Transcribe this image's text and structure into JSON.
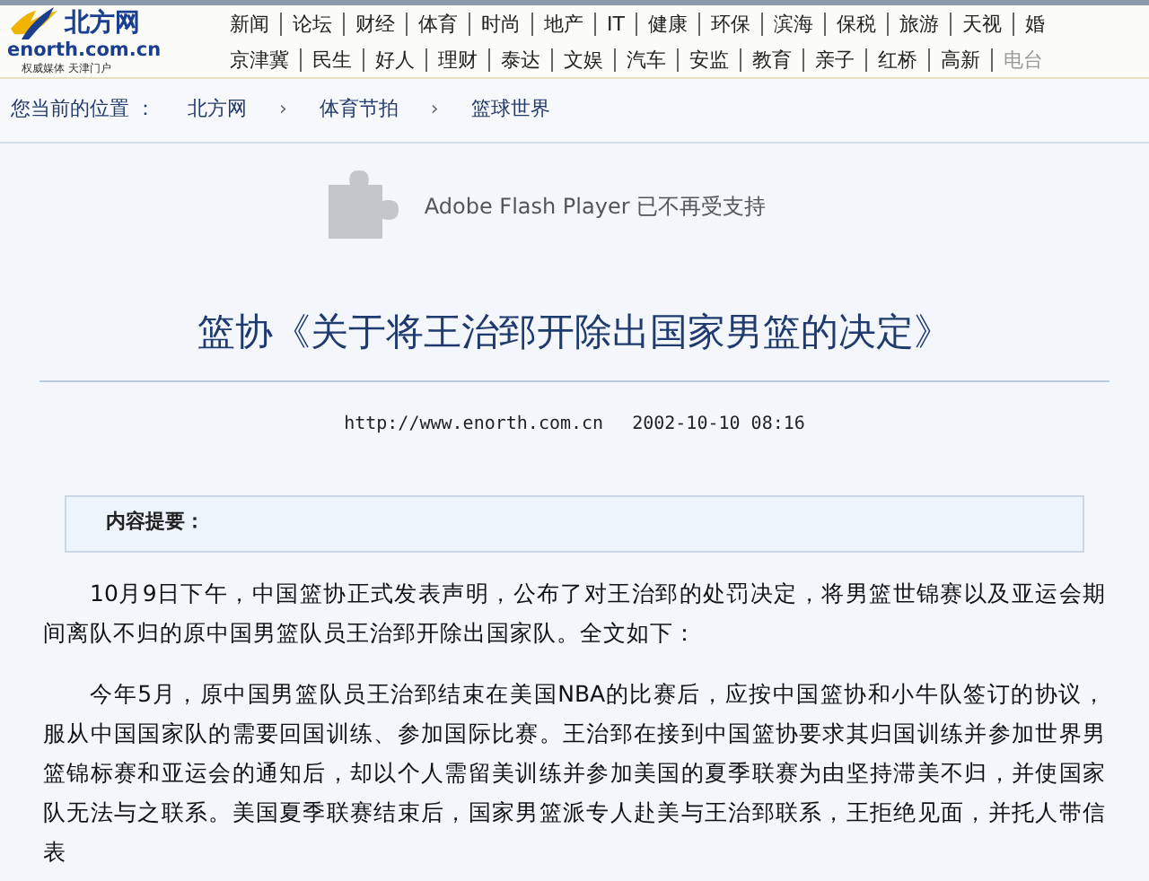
{
  "logo": {
    "name": "北方网",
    "domain": "enorth.com.cn",
    "slogan": "权威媒体 天津门户"
  },
  "nav_rows": [
    [
      "新闻",
      "论坛",
      "财经",
      "体育",
      "时尚",
      "地产",
      "IT",
      "健康",
      "环保",
      "滨海",
      "保税",
      "旅游",
      "天视",
      "婚"
    ],
    [
      "京津冀",
      "民生",
      "好人",
      "理财",
      "泰达",
      "文娱",
      "汽车",
      "安监",
      "教育",
      "亲子",
      "红桥",
      "高新",
      "电台"
    ]
  ],
  "breadcrumb": {
    "label": "您当前的位置 ：",
    "items": [
      "北方网",
      "体育节拍",
      "篮球世界"
    ],
    "separator": "›"
  },
  "plugin_notice": "Adobe Flash Player 已不再受支持",
  "article": {
    "title": "篮协《关于将王治郅开除出国家男篮的决定》",
    "source": "http://www.enorth.com.cn",
    "date": "2002-10-10 08:16",
    "summary_label": "内容提要：",
    "paragraphs": [
      "10月9日下午，中国篮协正式发表声明，公布了对王治郅的处罚决定，将男篮世锦赛以及亚运会期间离队不归的原中国男篮队员王治郅开除出国家队。全文如下：",
      "今年5月，原中国男篮队员王治郅结束在美国NBA的比赛后，应按中国篮协和小牛队签订的协议，服从中国国家队的需要回国训练、参加国际比赛。王治郅在接到中国篮协要求其归国训练并参加世界男篮锦标赛和亚运会的通知后，却以个人需留美训练并参加美国的夏季联赛为由坚持滞美不归，并使国家队无法与之联系。美国夏季联赛结束后，国家男篮派专人赴美与王治郅联系，王拒绝见面，并托人带信表"
    ]
  }
}
